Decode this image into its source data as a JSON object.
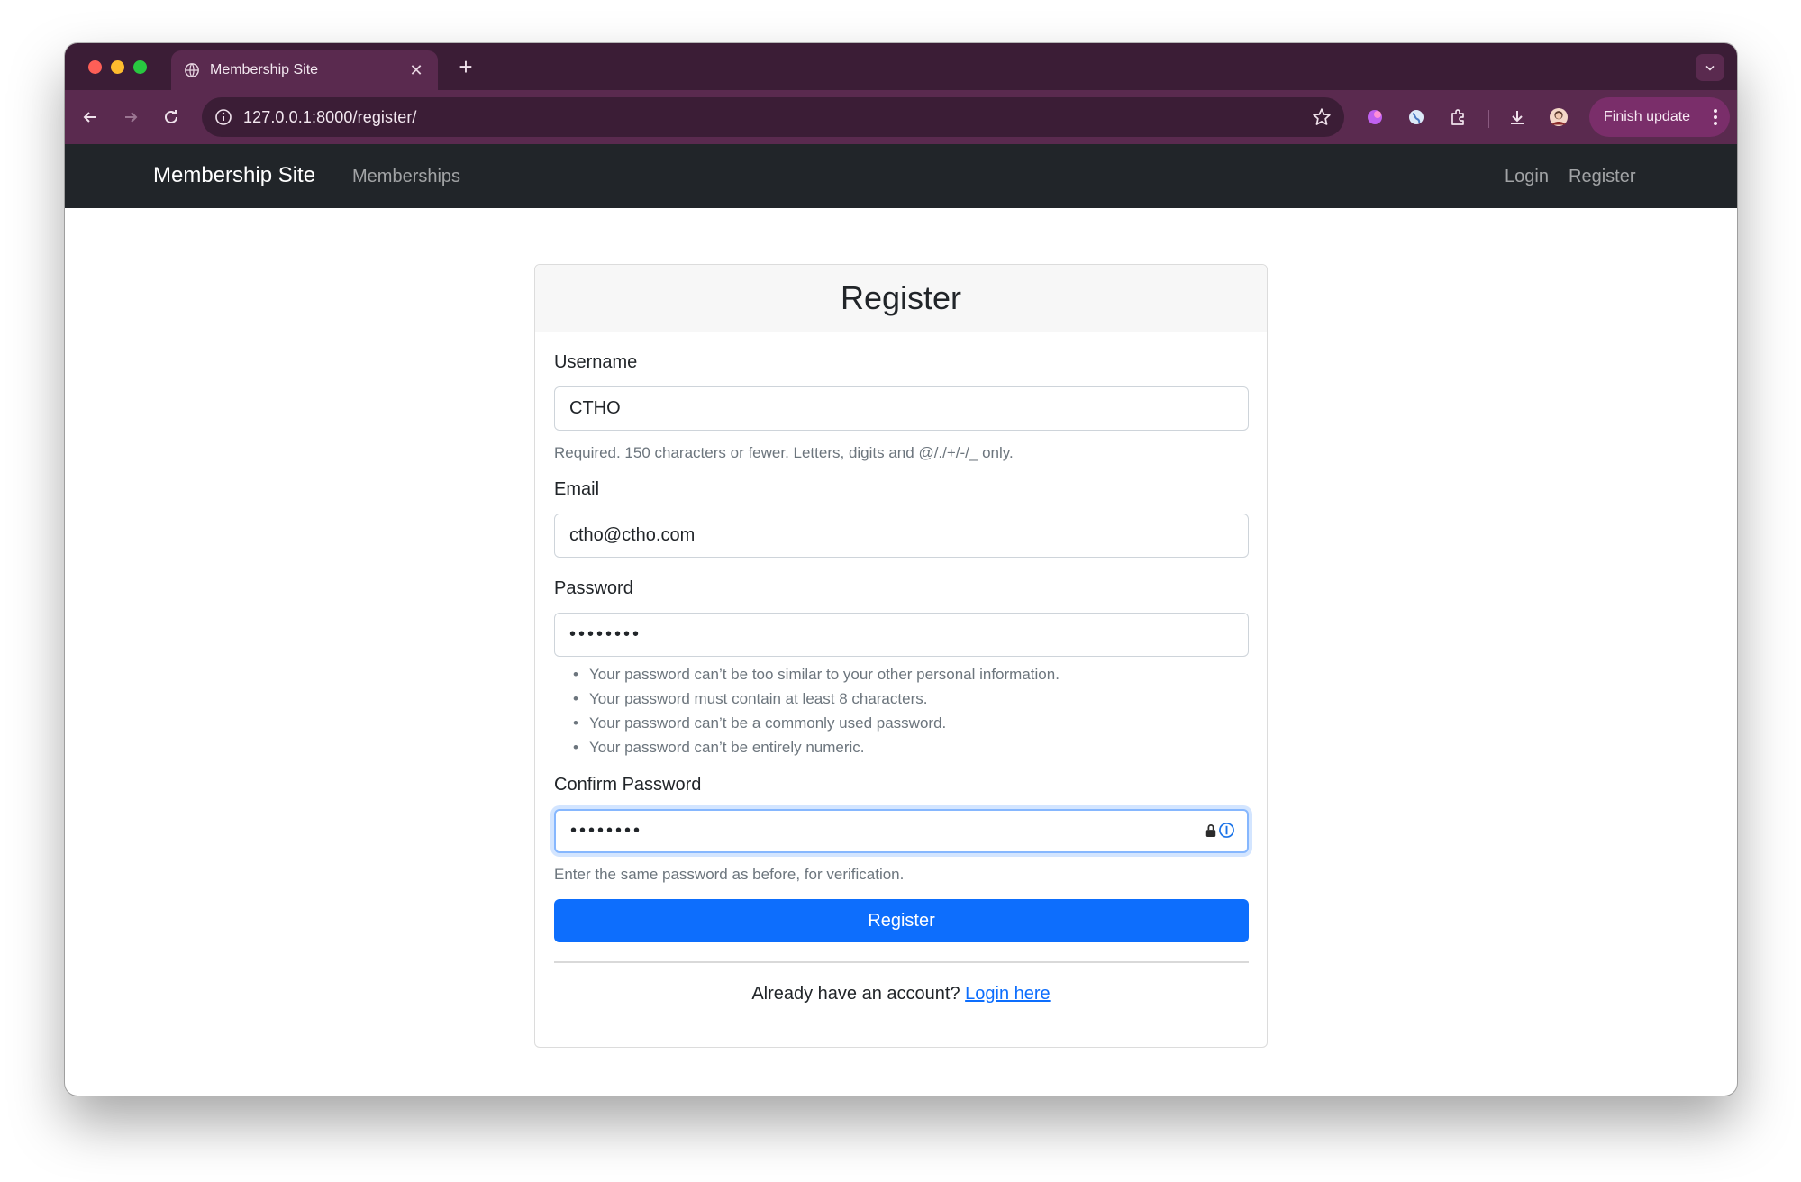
{
  "browser": {
    "tab_title": "Membership Site",
    "tab_close": "✕",
    "new_tab": "+",
    "url": "127.0.0.1:8000/register/",
    "finish_update": "Finish update",
    "colors": {
      "frame": "#3b1d36",
      "toolbar": "#5a2a4f",
      "update_button": "#7a2e6a"
    }
  },
  "navbar": {
    "brand": "Membership Site",
    "left_links": [
      "Memberships"
    ],
    "right_links": [
      "Login",
      "Register"
    ]
  },
  "card": {
    "title": "Register",
    "fields": {
      "username": {
        "label": "Username",
        "value": "CTHO",
        "help": "Required. 150 characters or fewer. Letters, digits and @/./+/-/_ only."
      },
      "email": {
        "label": "Email",
        "value": "ctho@ctho.com"
      },
      "password": {
        "label": "Password",
        "value_masked": "••••••••",
        "help_items": [
          "Your password can’t be too similar to your other personal information.",
          "Your password must contain at least 8 characters.",
          "Your password can’t be a commonly used password.",
          "Your password can’t be entirely numeric."
        ]
      },
      "confirm_password": {
        "label": "Confirm Password",
        "value_masked": "••••••••",
        "help": "Enter the same password as before, for verification."
      }
    },
    "submit_label": "Register",
    "footer_text": "Already have an account? ",
    "footer_link": "Login here",
    "primary_color": "#0d6efd"
  }
}
